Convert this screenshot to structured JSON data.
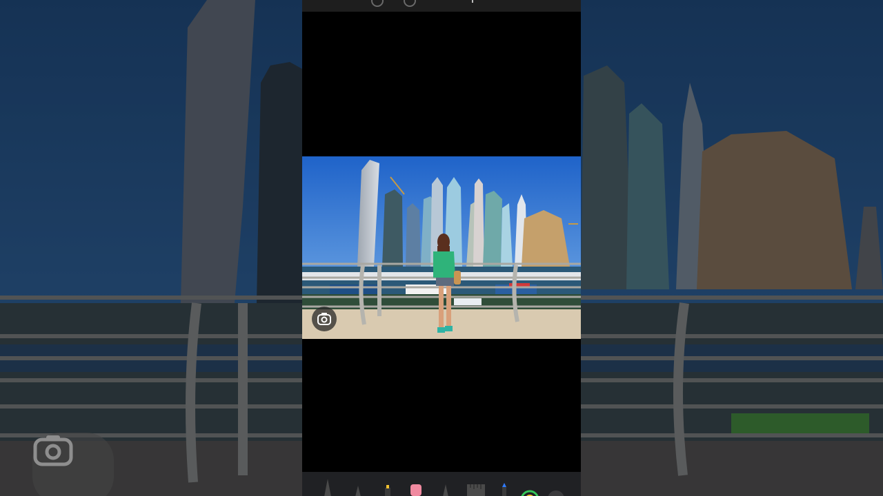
{
  "screen": {
    "description_free": true
  },
  "image_viewer": {
    "top_controls": [
      "circle-control",
      "circle-control"
    ],
    "lens_button_icon": "google-lens-icon"
  },
  "markup_toolbar": {
    "tools": [
      "pencil-tool",
      "pen-tool",
      "highlighter-tool",
      "eraser-tool",
      "fine-pen-tool",
      "ruler-tool",
      "marker-tool",
      "color-picker",
      "more-tool"
    ],
    "accent_color": "#34c759",
    "marker_color": "#2f7bff",
    "eraser_color": "#f08aa0",
    "highlighter_color": "#f2c230"
  }
}
